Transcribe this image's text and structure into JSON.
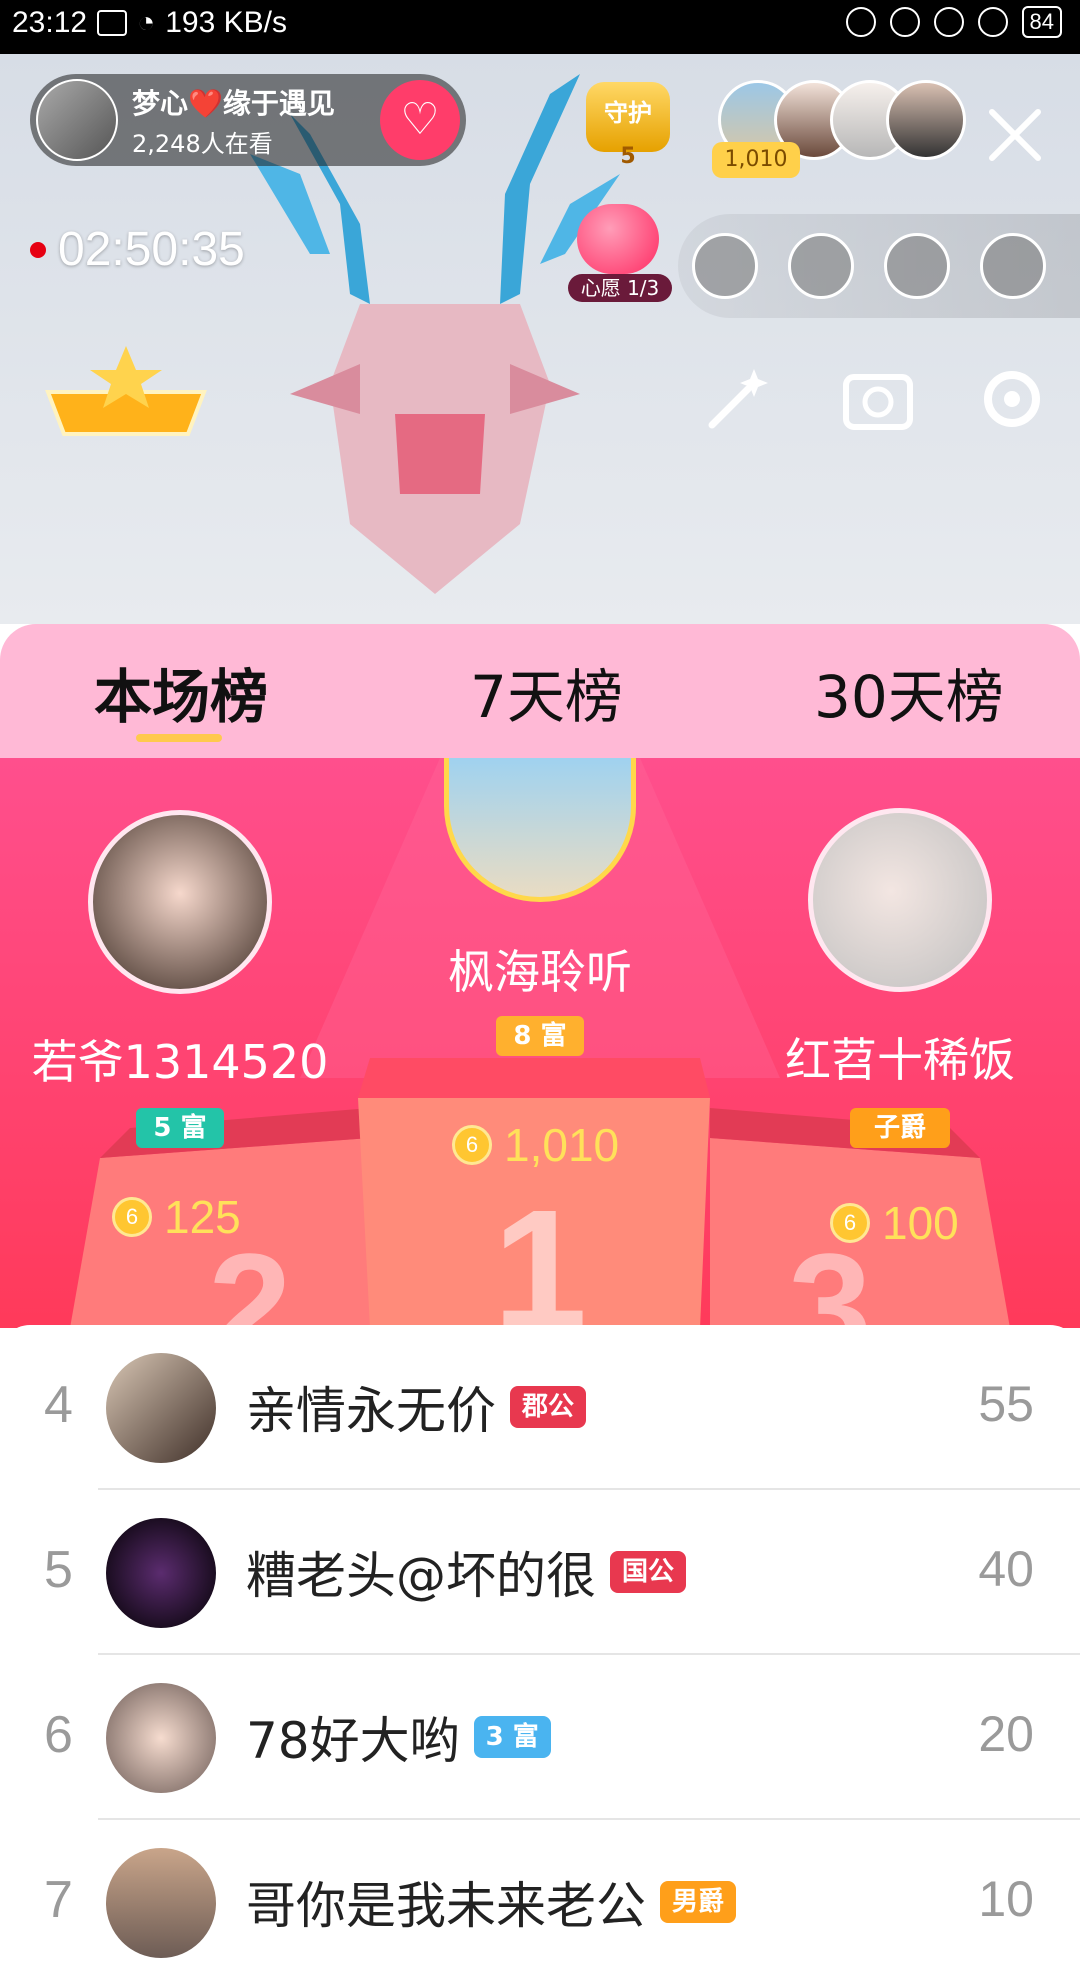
{
  "status_bar": {
    "time": "23:12",
    "speed": "193 KB/s",
    "battery": "84"
  },
  "live": {
    "host_name": "梦心❤️缘于遇见",
    "viewers": "2,248人在看",
    "timer": "02:50:35",
    "guard_label": "守护",
    "guard_level": "5",
    "viewer_contribution": "1,010",
    "wish_label": "心愿 1/3"
  },
  "tabs": [
    {
      "label": "本场榜"
    },
    {
      "label": "7天榜"
    },
    {
      "label": "30天榜"
    }
  ],
  "podium": {
    "first": {
      "name": "枫海聆听",
      "level": "8 富",
      "coins": "1,010"
    },
    "second": {
      "name": "若爷1314520",
      "level": "5 富",
      "coins": "125"
    },
    "third": {
      "name": "红苕十稀饭",
      "level": "子爵",
      "coins": "100"
    }
  },
  "list": [
    {
      "rank": "4",
      "name": "亲情永无价",
      "tag": "郡公",
      "score": "55"
    },
    {
      "rank": "5",
      "name": "糟老头@坏的很",
      "tag": "国公",
      "score": "40"
    },
    {
      "rank": "6",
      "name": "78好大哟",
      "tag": "3 富",
      "score": "20"
    },
    {
      "rank": "7",
      "name": "哥你是我未来老公",
      "tag": "男爵",
      "score": "10"
    }
  ],
  "colors": {
    "podium_bg": "#ff4f8d",
    "tabs_bg": "#ffb9d6",
    "coin": "#ffc631",
    "accent_gold": "#ffc94d"
  }
}
